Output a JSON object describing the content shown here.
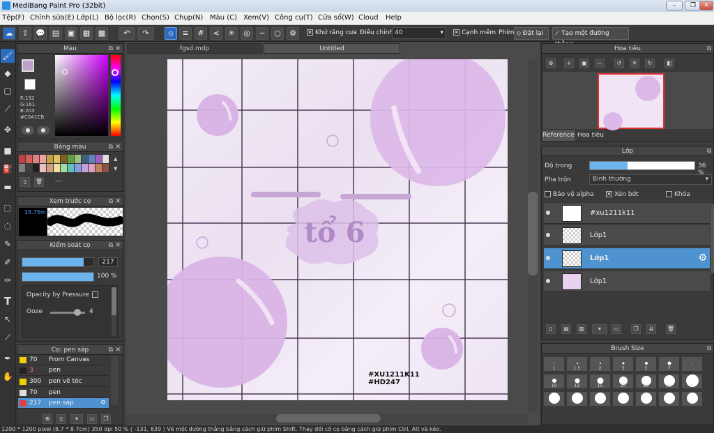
{
  "window": {
    "title": "MediBang Paint Pro (32bit)",
    "min_icon": "minimize-icon",
    "max_icon": "restore-icon",
    "close_icon": "close-icon"
  },
  "menu": [
    "Tệp(F)",
    "Chỉnh sửa(E)",
    "Lớp(L)",
    "Bộ lọc(R)",
    "Chọn(S)",
    "Chụp(N)",
    "Màu (C)",
    "Xem(V)",
    "Công cụ(T)",
    "Cửa sổ(W)",
    "Cloud",
    "Help"
  ],
  "toolbar": {
    "antialias_label": "Khử răng cưa",
    "correction_label": "Điều chỉnh",
    "correction_value": "40",
    "soft_edge_label": "Cạnh mềm",
    "key_label": "Phím",
    "reset_label": "Đặt lại",
    "make_line_label": "Tạo một đường thẳng"
  },
  "color_panel": {
    "title": "Màu",
    "r": "R:192",
    "g": "G:161",
    "b": "B:203",
    "hex": "#C0A1CB",
    "primary": "#C0A1CB",
    "secondary": "#ffffff"
  },
  "palette_panel": {
    "title": "Bảng màu",
    "more": "---"
  },
  "preview_panel": {
    "title": "Xem trước cọ",
    "size": "15.75m"
  },
  "brush_control": {
    "title": "Kiểm soát cọ",
    "size_value": "217",
    "opacity_value": "100 %",
    "opacity_pressure_label": "Opacity by Pressure",
    "ooze_label": "Ooze",
    "ooze_value": "4",
    "size_fraction": 0.86,
    "opacity_fraction": 1.0
  },
  "brush_list": {
    "title": "Cọ: pen sáp",
    "items": [
      {
        "size": "70",
        "name": "From Canvas",
        "color": "#f0d000"
      },
      {
        "size": "3",
        "name": "pen",
        "color": "#222222"
      },
      {
        "size": "300",
        "name": "pen vẽ tóc",
        "color": "#f0d000"
      },
      {
        "size": "70",
        "name": "pen",
        "color": "#dddddd"
      },
      {
        "size": "217",
        "name": "pen sáp",
        "color": "#e04040"
      }
    ]
  },
  "tabs": {
    "doc1": "fgsd.mdp",
    "doc2": "Untitled"
  },
  "canvas": {
    "text_line1": "#XU1211K11",
    "text_line2": "#HD247",
    "center_text": "tổ 6"
  },
  "navigator": {
    "title": "Hoa tiêu",
    "tab_reference": "Reference",
    "tab_navigator": "Hoa tiêu"
  },
  "layer_panel": {
    "title": "Lớp",
    "opacity_label": "Độ trong",
    "opacity_value": "36 %",
    "opacity_fraction": 0.36,
    "blend_label": "Pha trộn",
    "blend_value": "Bình thường",
    "protect_alpha": "Bảo vệ alpha",
    "clipping": "Xén bớt",
    "lock": "Khóa",
    "layers": [
      {
        "name": "#xu1211k11",
        "selected": false
      },
      {
        "name": "Lớp1",
        "selected": false
      },
      {
        "name": "Lớp1",
        "selected": true
      },
      {
        "name": "Lớp1",
        "selected": false
      }
    ]
  },
  "brush_size": {
    "title": "Brush Size",
    "row1": [
      "1",
      "1.5",
      "2",
      "3",
      "5",
      "7"
    ],
    "row2": [
      "10",
      "12",
      "15",
      "20",
      "25",
      "30",
      "40"
    ]
  },
  "status": "1200 * 1200 pixel  (8.7 * 8.7cm)  350 dpi  50 %  ( -131, 639 )  Vẽ một đường thẳng bằng cách giữ phím Shift. Thay đổi cỡ cọ bằng cách giữ phím Ctrl, Alt và kéo."
}
